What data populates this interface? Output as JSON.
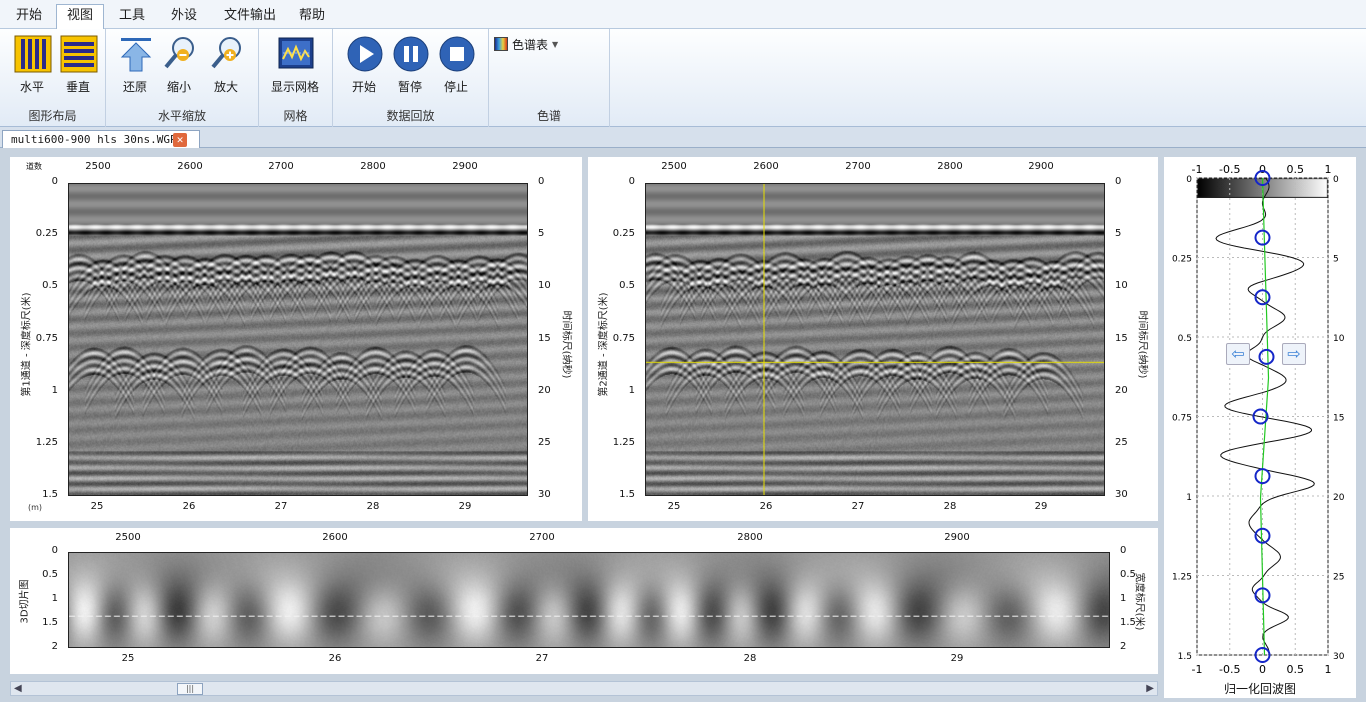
{
  "menubar": {
    "tabs": [
      "开始",
      "视图",
      "工具",
      "外设",
      "文件输出",
      "帮助"
    ],
    "active": "视图"
  },
  "ribbon": {
    "groups": {
      "layout": "图形布局",
      "hzoom": "水平缩放",
      "grid": "网格",
      "playback": "数据回放",
      "palette": "色谱"
    },
    "buttons": {
      "horizontal": "水平",
      "vertical": "垂直",
      "restore": "还原",
      "zoom_out": "缩小",
      "zoom_in": "放大",
      "show_grid": "显示网格",
      "start": "开始",
      "pause": "暂停",
      "stop": "停止",
      "palette": "色谱表"
    }
  },
  "document_tab": {
    "title": "multi600-900 hls 30ns.WGPR"
  },
  "panel1": {
    "corner_label": "道数",
    "top_ticks": [
      "2500",
      "2600",
      "2700",
      "2800",
      "2900"
    ],
    "left_ticks": [
      "0",
      "0.25",
      "0.5",
      "0.75",
      "1",
      "1.25",
      "1.5"
    ],
    "right_ticks": [
      "0",
      "5",
      "10",
      "15",
      "20",
      "25",
      "30"
    ],
    "bottom_ticks": [
      "25",
      "26",
      "27",
      "28",
      "29"
    ],
    "unit_label": "(m)",
    "left_title": "第1通道 - 深度标尺(米)",
    "right_title": "时间标尺(纳秒)"
  },
  "panel2": {
    "top_ticks": [
      "2500",
      "2600",
      "2700",
      "2800",
      "2900"
    ],
    "left_ticks": [
      "0",
      "0.25",
      "0.5",
      "0.75",
      "1",
      "1.25",
      "1.5"
    ],
    "right_ticks": [
      "0",
      "5",
      "10",
      "15",
      "20",
      "25",
      "30"
    ],
    "bottom_ticks": [
      "25",
      "26",
      "27",
      "28",
      "29"
    ],
    "left_title": "第2通道 - 深度标尺(米)",
    "right_title": "时间标尺(纳秒)",
    "cursor": {
      "trace": 2600,
      "depth_m": 0.86
    }
  },
  "panel3": {
    "top_ticks": [
      "2500",
      "2600",
      "2700",
      "2800",
      "2900"
    ],
    "left_ticks": [
      "0",
      "0.5",
      "1",
      "1.5",
      "2"
    ],
    "right_ticks": [
      "0",
      "0.5",
      "1",
      "1.5",
      "2"
    ],
    "bottom_ticks": [
      "25",
      "26",
      "27",
      "28",
      "29"
    ],
    "left_title": "3D切片图",
    "right_title": "宽度标尺(米)"
  },
  "waveform": {
    "top_ticks": [
      "-1",
      "-0.5",
      "0",
      "0.5",
      "1"
    ],
    "bottom_ticks": [
      "-1",
      "-0.5",
      "0",
      "0.5",
      "1"
    ],
    "left_ticks": [
      "0",
      "0.25",
      "0.5",
      "0.75",
      "1",
      "1.25",
      "1.5"
    ],
    "right_ticks": [
      "5",
      "10",
      "15",
      "20",
      "25",
      "30"
    ],
    "right_first_tick": "0",
    "title": "归一化回波图"
  },
  "colors": {
    "accent": "#2f63b6",
    "cursor": "#e8e000",
    "marker": "#1426c8",
    "trend": "#22c822"
  },
  "icons": [
    "columns-icon",
    "rows-icon",
    "restore-arrow-icon",
    "zoom-out-icon",
    "zoom-in-icon",
    "grid-chart-icon",
    "play-icon",
    "pause-icon",
    "stop-icon",
    "palette-icon",
    "close-icon",
    "arrow-left-icon",
    "arrow-right-icon"
  ]
}
